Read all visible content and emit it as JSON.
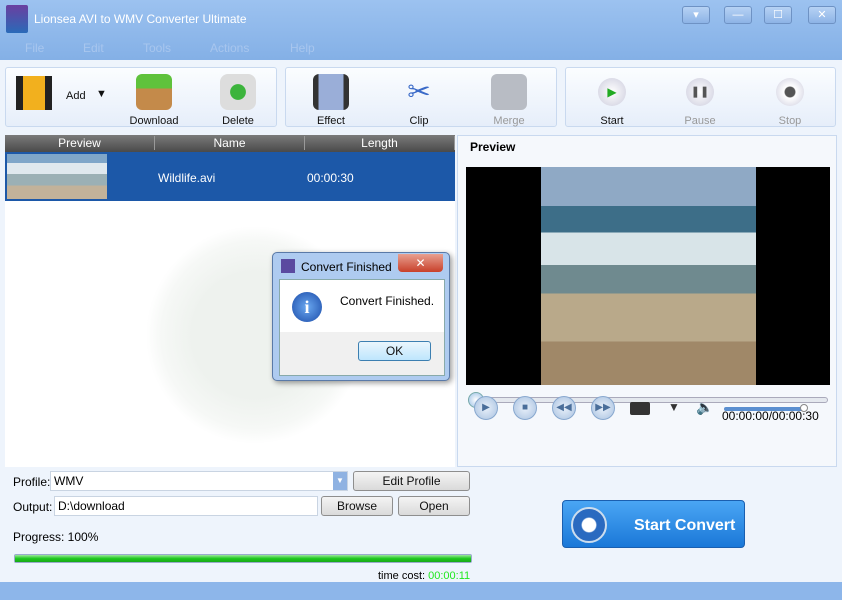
{
  "app": {
    "title": "Lionsea AVI to WMV Converter Ultimate",
    "window_buttons": [
      "▾",
      "—",
      "☐",
      "✕"
    ]
  },
  "menu": [
    "File",
    "Edit",
    "Tools",
    "Actions",
    "Help"
  ],
  "toolbar": {
    "add": "Add",
    "download": "Download",
    "delete": "Delete",
    "effect": "Effect",
    "clip": "Clip",
    "merge": "Merge",
    "start": "Start",
    "pause": "Pause",
    "stop": "Stop"
  },
  "list": {
    "columns": [
      "Preview",
      "Name",
      "Length"
    ],
    "rows": [
      {
        "name": "Wildlife.avi",
        "length": "00:00:30"
      }
    ]
  },
  "preview": {
    "title": "Preview",
    "time": "00:00:00/00:00:30",
    "seek_progress": 0,
    "volume": 0.95
  },
  "profile": {
    "label": "Profile:",
    "value": "WMV",
    "edit": "Edit Profile"
  },
  "output": {
    "label": "Output:",
    "value": "D:\\download",
    "browse": "Browse",
    "open": "Open"
  },
  "progress": {
    "label": "Progress: 100%",
    "value": 100,
    "time_cost_label": "time cost:",
    "time_cost": "00:00:11"
  },
  "start_convert": "Start Convert",
  "dialog": {
    "title": "Convert Finished",
    "message": "Convert Finished.",
    "ok": "OK",
    "close": "✕"
  },
  "colors": {
    "progress": "#1ec81e",
    "accent": "#1c58a8",
    "time_cost": "#1ee81e"
  }
}
